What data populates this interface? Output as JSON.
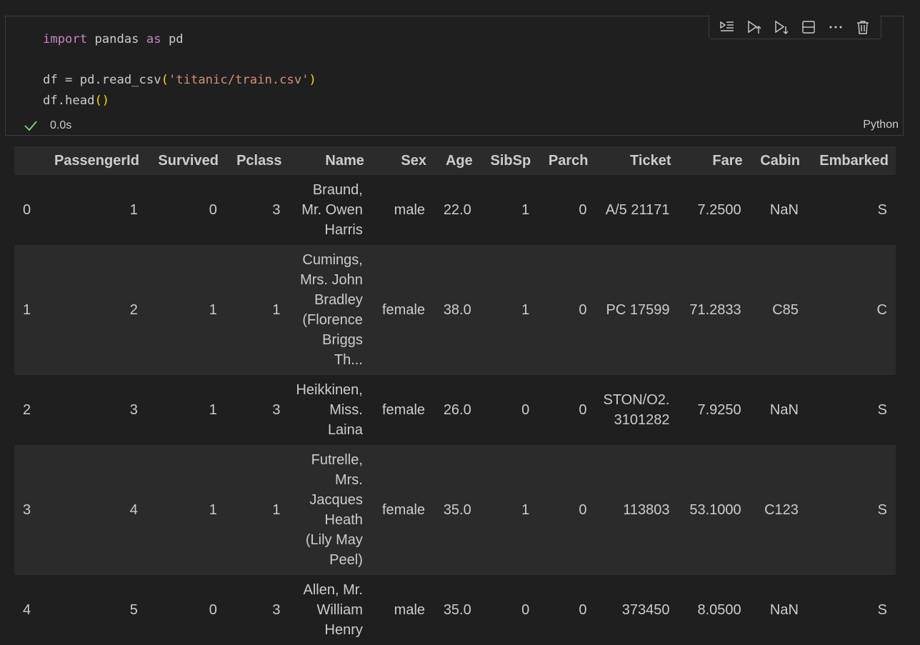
{
  "cell": {
    "code_lines": [
      [
        {
          "t": "import",
          "c": "kw"
        },
        {
          "t": " pandas ",
          "c": ""
        },
        {
          "t": "as",
          "c": "kw"
        },
        {
          "t": " pd",
          "c": ""
        }
      ],
      [],
      [
        {
          "t": "df = pd.read_csv",
          "c": ""
        },
        {
          "t": "(",
          "c": "paren"
        },
        {
          "t": "'titanic/train.csv'",
          "c": "str"
        },
        {
          "t": ")",
          "c": "paren"
        }
      ],
      [
        {
          "t": "df.head",
          "c": ""
        },
        {
          "t": "()",
          "c": "paren"
        }
      ]
    ],
    "exec_time": "0.0s",
    "language": "Python",
    "status_color": "#89d185"
  },
  "toolbar": {
    "buttons": [
      {
        "name": "execute-above-cells-icon"
      },
      {
        "name": "execute-cell-and-above-icon"
      },
      {
        "name": "execute-cell-and-below-icon"
      },
      {
        "name": "split-cell-icon"
      },
      {
        "name": "more-actions-icon"
      },
      {
        "name": "delete-cell-icon"
      }
    ]
  },
  "dataframe": {
    "columns": [
      "",
      "PassengerId",
      "Survived",
      "Pclass",
      "Name",
      "Sex",
      "Age",
      "SibSp",
      "Parch",
      "Ticket",
      "Fare",
      "Cabin",
      "Embarked"
    ],
    "rows": [
      [
        "0",
        "1",
        "0",
        "3",
        "Braund, Mr. Owen Harris",
        "male",
        "22.0",
        "1",
        "0",
        "A/5 21171",
        "7.2500",
        "NaN",
        "S"
      ],
      [
        "1",
        "2",
        "1",
        "1",
        "Cumings, Mrs. John Bradley (Florence Briggs Th...",
        "female",
        "38.0",
        "1",
        "0",
        "PC 17599",
        "71.2833",
        "C85",
        "C"
      ],
      [
        "2",
        "3",
        "1",
        "3",
        "Heikkinen, Miss. Laina",
        "female",
        "26.0",
        "0",
        "0",
        "STON/O2. 3101282",
        "7.9250",
        "NaN",
        "S"
      ],
      [
        "3",
        "4",
        "1",
        "1",
        "Futrelle, Mrs. Jacques Heath (Lily May Peel)",
        "female",
        "35.0",
        "1",
        "0",
        "113803",
        "53.1000",
        "C123",
        "S"
      ],
      [
        "4",
        "5",
        "0",
        "3",
        "Allen, Mr. William Henry",
        "male",
        "35.0",
        "0",
        "0",
        "373450",
        "8.0500",
        "NaN",
        "S"
      ]
    ]
  }
}
